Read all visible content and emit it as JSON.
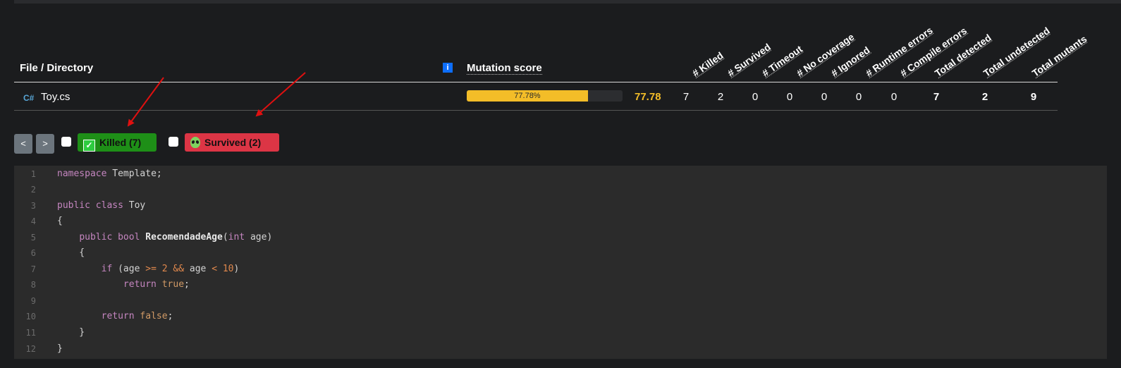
{
  "table": {
    "file_header": "File / Directory",
    "info_icon_label": "i",
    "score_header": "Mutation score",
    "columns": [
      "# Killed",
      "# Survived",
      "# Timeout",
      "# No coverage",
      "# Ignored",
      "# Runtime errors",
      "# Compile errors",
      "Total detected",
      "Total undetected",
      "Total mutants"
    ],
    "row": {
      "file_icon": "C#",
      "file_name": "Toy.cs",
      "score_percent_label": "77.78%",
      "score_fraction": 0.7778,
      "score": "77.78",
      "values": [
        "7",
        "2",
        "0",
        "0",
        "0",
        "0",
        "0",
        "7",
        "2",
        "9"
      ]
    }
  },
  "filters": {
    "prev": "<",
    "next": ">",
    "killed_label": "Killed (7)",
    "survived_label": "Survived (2)",
    "killed_icon": "✓"
  },
  "code": {
    "lines": [
      "namespace Template;",
      "",
      "public class Toy",
      "{",
      "    public bool RecomendadeAge(int age)",
      "    {",
      "        if (age >= 2 && age < 10)",
      "            return true;",
      "",
      "        return false;",
      "    }",
      "}"
    ],
    "line_numbers": [
      "1",
      "2",
      "3",
      "4",
      "5",
      "6",
      "7",
      "8",
      "9",
      "10",
      "11",
      "12"
    ]
  },
  "colors": {
    "score": "#f3bd28",
    "killed": "#1e8f17",
    "survived": "#dc3545",
    "arrow": "#e01010"
  }
}
